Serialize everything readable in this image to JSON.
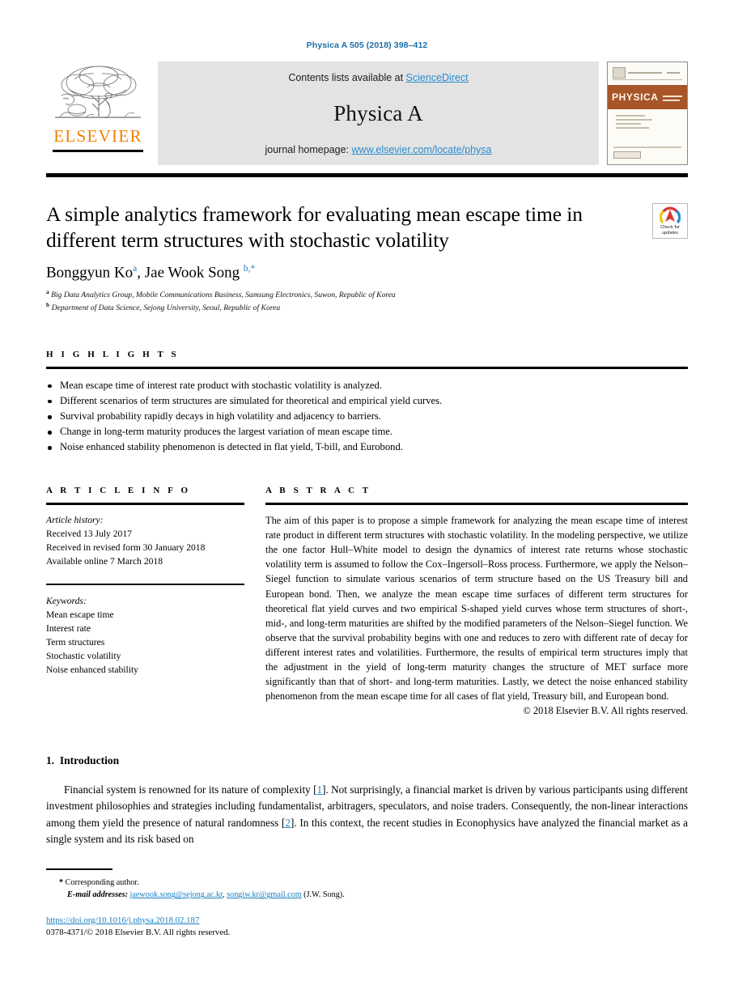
{
  "running_head": "Physica A 505 (2018) 398–412",
  "masthead": {
    "publisher": "ELSEVIER",
    "contents_prefix": "Contents lists available at ",
    "contents_link": "ScienceDirect",
    "journal_title": "Physica A",
    "homepage_prefix": "journal homepage: ",
    "homepage_url": "www.elsevier.com/locate/physa",
    "cover_title": "PHYSICA",
    "cover_subtitle_1": "STATISTICAL MECHANICS",
    "cover_subtitle_2": "AND ITS APPLICATIONS"
  },
  "article": {
    "title": "A simple analytics framework for evaluating mean escape time in different term structures with stochastic volatility",
    "authors": [
      {
        "name": "Bonggyun Ko",
        "marks": "a"
      },
      {
        "name": "Jae Wook Song",
        "marks": "b,*"
      }
    ],
    "affiliations": [
      {
        "mark": "a",
        "text": "Big Data Analytics Group, Mobile Communications Business, Samsung Electronics, Suwon, Republic of Korea"
      },
      {
        "mark": "b",
        "text": "Department of Data Science, Sejong University, Seoul, Republic of Korea"
      }
    ],
    "crossmark_line1": "Check for",
    "crossmark_line2": "updates"
  },
  "highlights": {
    "heading": "H I G H L I G H T S",
    "items": [
      "Mean escape time of interest rate product with stochastic volatility is analyzed.",
      "Different scenarios of term structures are simulated for theoretical and empirical yield curves.",
      "Survival probability rapidly decays in high volatility and adjacency to barriers.",
      "Change in long-term maturity produces the largest variation of mean escape time.",
      "Noise enhanced stability phenomenon is detected in flat yield, T-bill, and Eurobond."
    ]
  },
  "article_info": {
    "heading": "A R T I C L E    I N F O",
    "history_label": "Article history:",
    "history": [
      "Received 13 July 2017",
      "Received in revised form 30 January 2018",
      "Available online 7 March 2018"
    ],
    "keywords_label": "Keywords:",
    "keywords": [
      "Mean escape time",
      "Interest rate",
      "Term structures",
      "Stochastic volatility",
      "Noise enhanced stability"
    ]
  },
  "abstract": {
    "heading": "A B S T R A C T",
    "body": "The aim of this paper is to propose a simple framework for analyzing the mean escape time of interest rate product in different term structures with stochastic volatility. In the modeling perspective, we utilize the one factor Hull–White model to design the dynamics of interest rate returns whose stochastic volatility term is assumed to follow the Cox–Ingersoll–Ross process. Furthermore, we apply the Nelson–Siegel function to simulate various scenarios of term structure based on the US Treasury bill and European bond. Then, we analyze the mean escape time surfaces of different term structures for theoretical flat yield curves and two empirical S-shaped yield curves whose term structures of short-, mid-, and long-term maturities are shifted by the modified parameters of the Nelson–Siegel function. We observe that the survival probability begins with one and reduces to zero with different rate of decay for different interest rates and volatilities. Furthermore, the results of empirical term structures imply that the adjustment in the yield of long-term maturity changes the structure of MET surface more significantly than that of short- and long-term maturities. Lastly, we detect the noise enhanced stability phenomenon from the mean escape time for all cases of flat yield, Treasury bill, and European bond.",
    "copyright": "© 2018 Elsevier B.V. All rights reserved."
  },
  "introduction": {
    "number": "1.",
    "heading": "Introduction",
    "para_1a": "Financial system is renowned for its nature of complexity [",
    "ref_1": "1",
    "para_1b": "]. Not surprisingly, a financial market is driven by various participants using different investment philosophies and strategies including fundamentalist, arbitragers, speculators, and noise traders. Consequently, the non-linear interactions among them yield the presence of natural randomness [",
    "ref_2": "2",
    "para_1c": "]. In this context, the recent studies in Econophysics have analyzed the financial market as a single system and its risk based on"
  },
  "footer": {
    "corresponding_star": "*",
    "corresponding_label": "Corresponding author.",
    "email_label": "E-mail addresses:",
    "email_1": "jaewook.song@sejong.ac.kr",
    "email_sep": ", ",
    "email_2": "songjw.kr@gmail.com",
    "email_suffix": " (J.W. Song).",
    "doi": "https://doi.org/10.1016/j.physa.2018.02.187",
    "issn_line": "0378-4371/© 2018 Elsevier B.V. All rights reserved."
  },
  "colors": {
    "link_blue": "#1a7fc1",
    "elsevier_orange": "#f08000",
    "cover_band": "#a8552a"
  }
}
